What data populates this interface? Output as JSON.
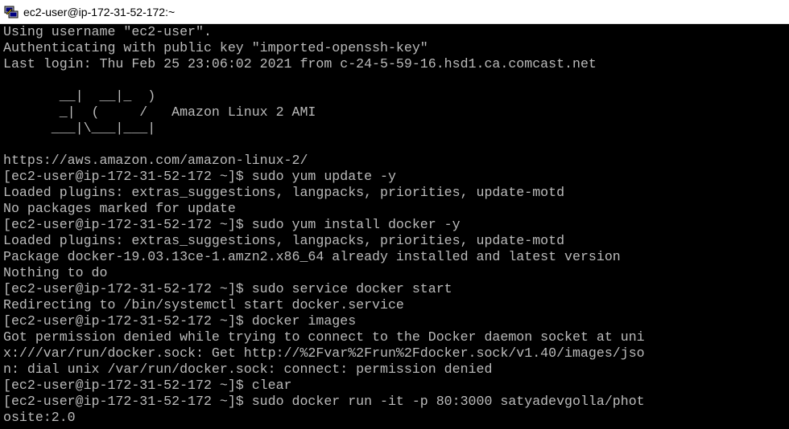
{
  "window": {
    "title": "ec2-user@ip-172-31-52-172:~",
    "icon": "putty-terminal-icon",
    "colors": {
      "titlebar_bg": "#ffffff",
      "terminal_bg": "#000000",
      "terminal_fg": "#bbbbbb"
    }
  },
  "terminal": {
    "lines": [
      "Using username \"ec2-user\".",
      "Authenticating with public key \"imported-openssh-key\"",
      "Last login: Thu Feb 25 23:06:02 2021 from c-24-5-59-16.hsd1.ca.comcast.net",
      "",
      "       __|  __|_  )",
      "       _|  (     /   Amazon Linux 2 AMI",
      "      ___|\\___|___|",
      "",
      "https://aws.amazon.com/amazon-linux-2/",
      "[ec2-user@ip-172-31-52-172 ~]$ sudo yum update -y",
      "Loaded plugins: extras_suggestions, langpacks, priorities, update-motd",
      "No packages marked for update",
      "[ec2-user@ip-172-31-52-172 ~]$ sudo yum install docker -y",
      "Loaded plugins: extras_suggestions, langpacks, priorities, update-motd",
      "Package docker-19.03.13ce-1.amzn2.x86_64 already installed and latest version",
      "Nothing to do",
      "[ec2-user@ip-172-31-52-172 ~]$ sudo service docker start",
      "Redirecting to /bin/systemctl start docker.service",
      "[ec2-user@ip-172-31-52-172 ~]$ docker images",
      "Got permission denied while trying to connect to the Docker daemon socket at uni",
      "x:///var/run/docker.sock: Get http://%2Fvar%2Frun%2Fdocker.sock/v1.40/images/jso",
      "n: dial unix /var/run/docker.sock: connect: permission denied",
      "[ec2-user@ip-172-31-52-172 ~]$ clear",
      "[ec2-user@ip-172-31-52-172 ~]$ sudo docker run -it -p 80:3000 satyadevgolla/phot",
      "osite:2.0"
    ]
  }
}
